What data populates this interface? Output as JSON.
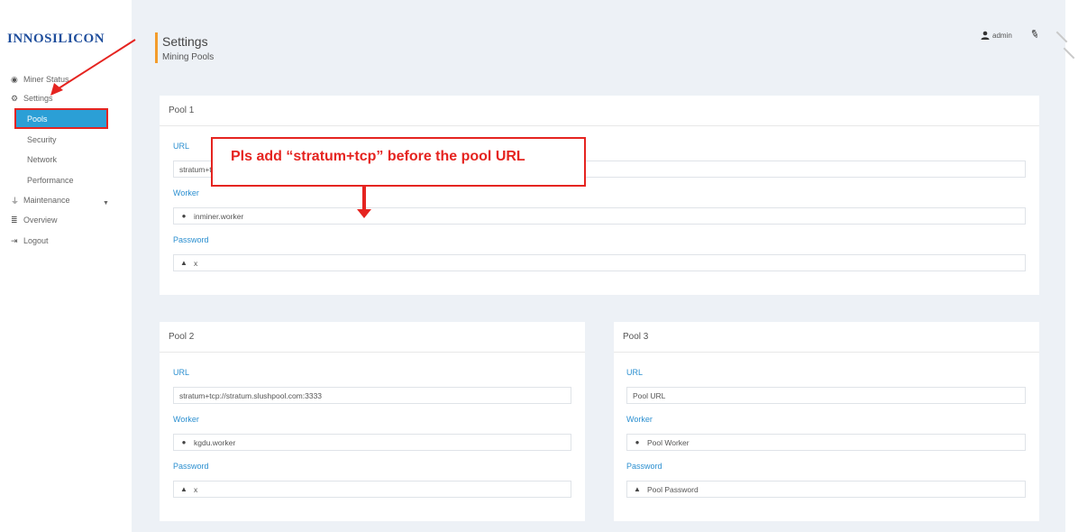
{
  "brand": {
    "logo_text": "INNOSILICON"
  },
  "sidebar": {
    "items": [
      {
        "label": "Miner Status",
        "icon": "dashboard-icon"
      },
      {
        "label": "Settings",
        "icon": "cogs-icon"
      },
      {
        "label": "Maintenance",
        "icon": "plug-icon"
      },
      {
        "label": "Overview",
        "icon": "list-icon"
      },
      {
        "label": "Logout",
        "icon": "sign-out-icon"
      }
    ],
    "settings_sub": [
      "Pools",
      "Security",
      "Network",
      "Performance"
    ]
  },
  "header": {
    "title": "Settings",
    "subtitle": "Mining Pools",
    "user": "admin"
  },
  "pools": [
    {
      "title": "Pool 1",
      "url_label": "URL",
      "url_value": "stratum+tcp://btc-bj.ss.poolin.com:1800",
      "worker_label": "Worker",
      "worker_value": "inminer.worker",
      "password_label": "Password",
      "password_value": "x"
    },
    {
      "title": "Pool 2",
      "url_label": "URL",
      "url_value": "stratum+tcp://stratum.slushpool.com:3333",
      "worker_label": "Worker",
      "worker_value": "kgdu.worker",
      "password_label": "Password",
      "password_value": "x"
    },
    {
      "title": "Pool 3",
      "url_label": "URL",
      "url_placeholder": "Pool URL",
      "worker_label": "Worker",
      "worker_placeholder": "Pool Worker",
      "password_label": "Password",
      "password_placeholder": "Pool Password"
    }
  ],
  "annotation": {
    "callout": "Pls add “stratum+tcp” before the pool URL"
  },
  "colors": {
    "accent": "#2b9fd6",
    "header_bar": "#f39c2b",
    "annotation": "#e52420",
    "brand": "#1f4e9c"
  }
}
